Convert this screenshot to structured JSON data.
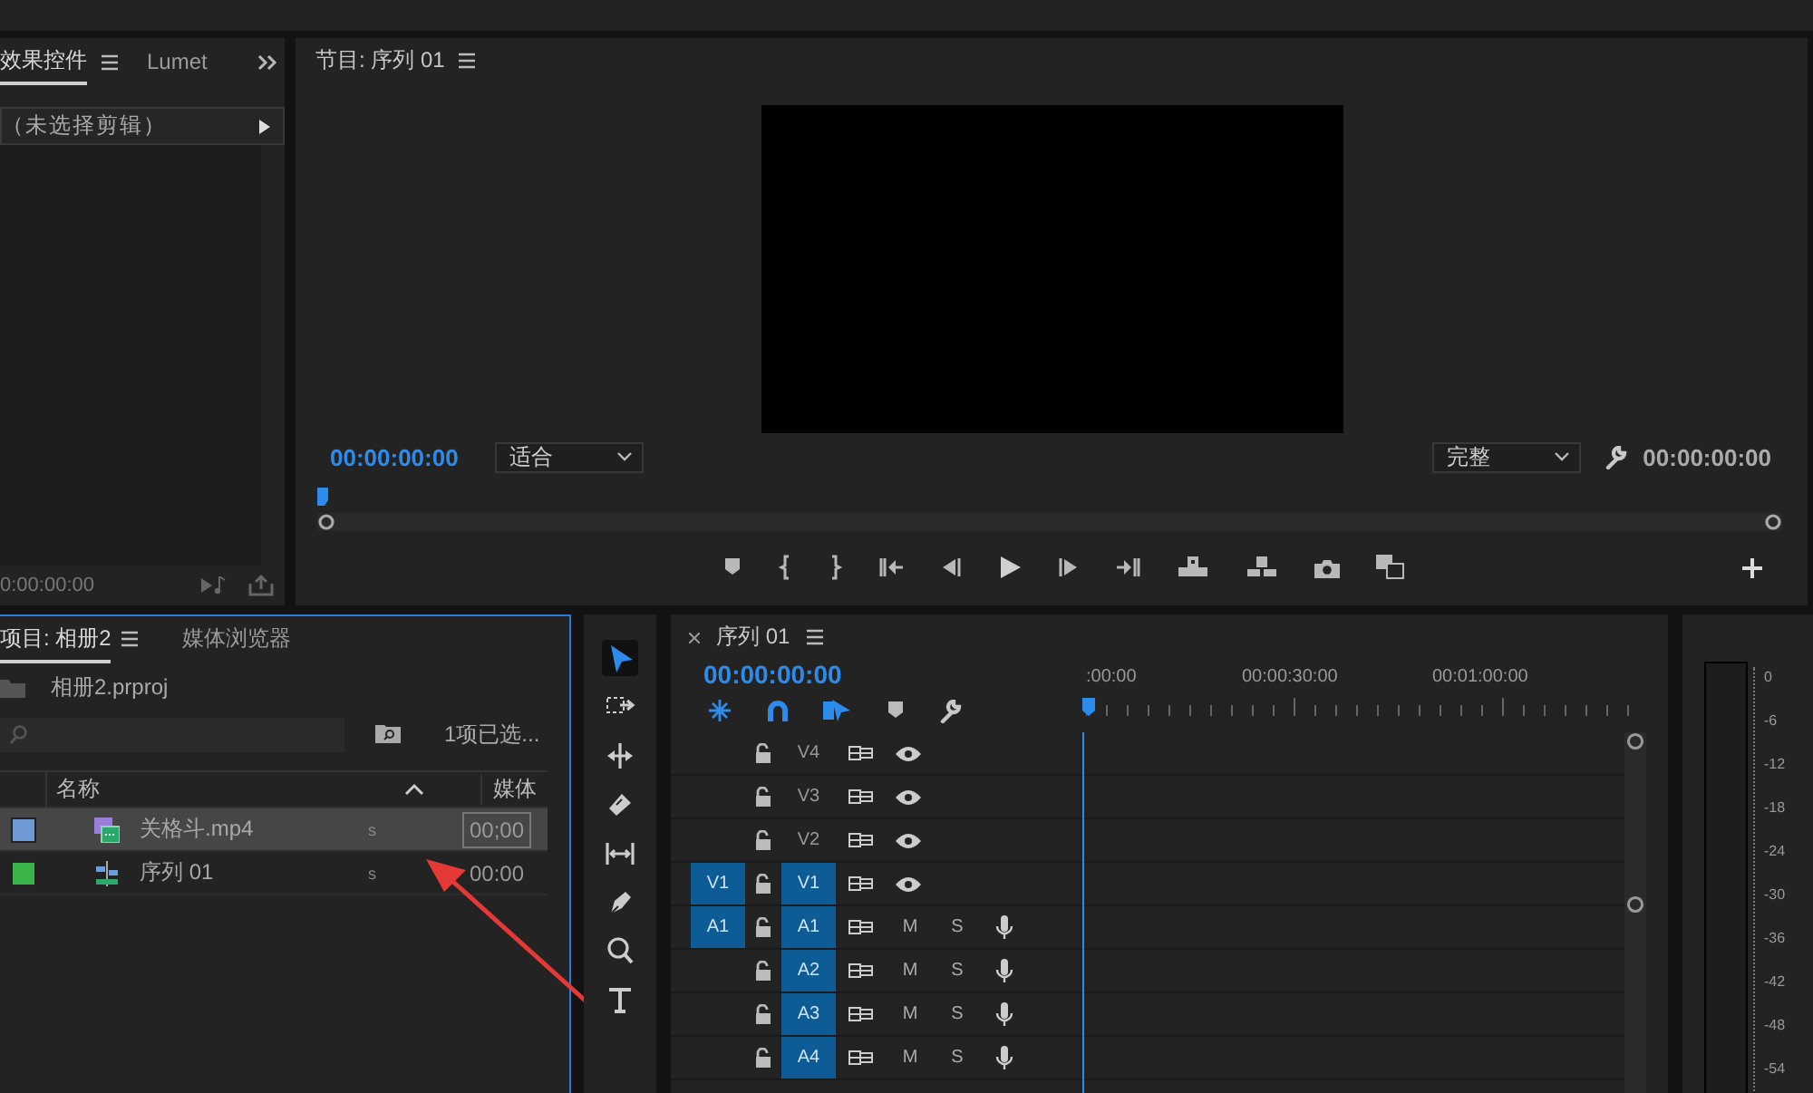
{
  "effect_controls": {
    "tabs": [
      {
        "label": "效果控件",
        "selected": true
      },
      {
        "label": "Lumet",
        "selected": false
      }
    ],
    "clip_selector": "（未选择剪辑）",
    "timecode": "0:00:00:00"
  },
  "program_monitor": {
    "title": "节目: 序列 01",
    "timecode": "00:00:00:00",
    "zoom": "适合",
    "quality": "完整",
    "duration": "00:00:00:00"
  },
  "project": {
    "tabs": [
      {
        "label": "项目: 相册2",
        "selected": true
      },
      {
        "label": "媒体浏览器",
        "selected": false
      }
    ],
    "file": "相册2.prproj",
    "selection_count": "1项已选...",
    "columns": [
      "名称",
      "媒体"
    ],
    "rows": [
      {
        "name": "关格斗.mp4",
        "kind": "video",
        "color": "#6f9ad6",
        "column_3": "s",
        "media_start": "00;00",
        "selected": true
      },
      {
        "name": "序列 01",
        "kind": "sequence",
        "color": "#3bb54a",
        "column_3": "s",
        "media_start": "00:00",
        "selected": false
      }
    ]
  },
  "tools": [
    {
      "kind": "selection",
      "selected": true
    },
    {
      "kind": "track-select",
      "selected": false
    },
    {
      "kind": "ripple",
      "selected": false
    },
    {
      "kind": "razor",
      "selected": false
    },
    {
      "kind": "slip",
      "selected": false
    },
    {
      "kind": "pen",
      "selected": false
    },
    {
      "kind": "zoom",
      "selected": false
    },
    {
      "kind": "type",
      "selected": false
    }
  ],
  "timeline": {
    "title": "序列 01",
    "timecode": "00:00:00:00",
    "ruler": [
      ":00:00",
      "00:00:30:00",
      "00:01:00:00"
    ],
    "tracks": [
      {
        "kind": "video",
        "label": "V4",
        "targeted": false
      },
      {
        "kind": "video",
        "label": "V3",
        "targeted": false
      },
      {
        "kind": "video",
        "label": "V2",
        "targeted": false
      },
      {
        "kind": "video",
        "label": "V1",
        "source": "V1",
        "targeted": true
      },
      {
        "kind": "audio",
        "label": "A1",
        "source": "A1",
        "targeted": true,
        "mute": "M",
        "solo": "S"
      },
      {
        "kind": "audio",
        "label": "A2",
        "targeted": true,
        "mute": "M",
        "solo": "S"
      },
      {
        "kind": "audio",
        "label": "A3",
        "targeted": true,
        "mute": "M",
        "solo": "S"
      },
      {
        "kind": "audio",
        "label": "A4",
        "targeted": true,
        "mute": "M",
        "solo": "S"
      }
    ]
  },
  "audio_meter": {
    "scale": [
      "0",
      "-6",
      "-12",
      "-18",
      "-24",
      "-30",
      "-36",
      "-42",
      "-48",
      "-54"
    ]
  }
}
